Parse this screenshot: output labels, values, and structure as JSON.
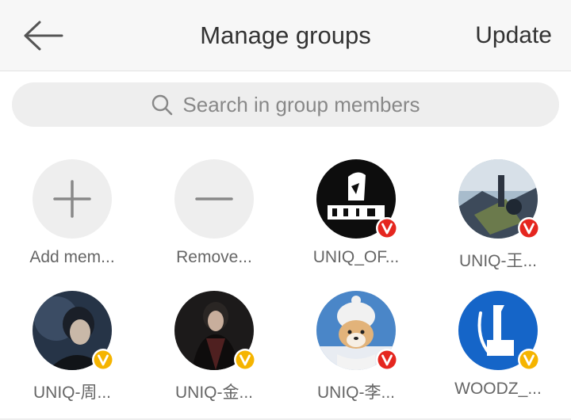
{
  "header": {
    "title": "Manage groups",
    "update_label": "Update"
  },
  "search": {
    "placeholder": "Search in group members"
  },
  "members": [
    {
      "label": "Add mem...",
      "kind": "add-action"
    },
    {
      "label": "Remove...",
      "kind": "remove-action"
    },
    {
      "label": "UNIQ_OF...",
      "kind": "member",
      "badge_color": "#e5261f"
    },
    {
      "label": "UNIQ-王...",
      "kind": "member",
      "badge_color": "#e5261f"
    },
    {
      "label": "UNIQ-周...",
      "kind": "member",
      "badge_color": "#f5b400"
    },
    {
      "label": "UNIQ-金...",
      "kind": "member",
      "badge_color": "#f5b400"
    },
    {
      "label": "UNIQ-李...",
      "kind": "member",
      "badge_color": "#e5261f"
    },
    {
      "label": "WOODZ_...",
      "kind": "member",
      "badge_color": "#f5b400"
    }
  ],
  "colors": {
    "header_bg": "#f7f7f7",
    "search_bg": "#eeeeee",
    "verified_red": "#e5261f",
    "verified_gold": "#f5b400"
  }
}
